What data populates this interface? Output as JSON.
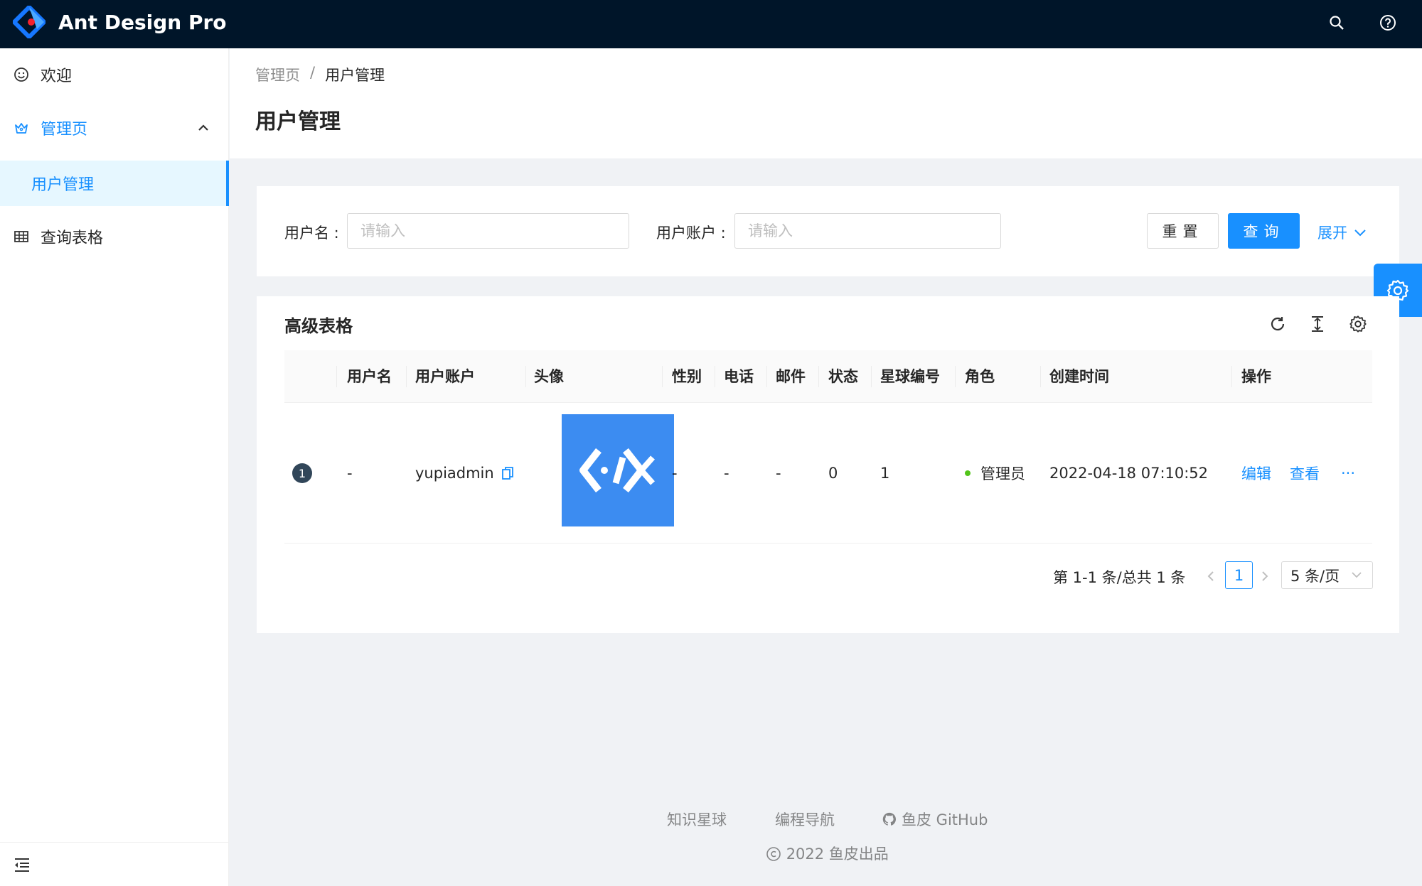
{
  "header": {
    "app_title": "Ant Design Pro",
    "icons": [
      "search-icon",
      "question-circle-icon"
    ]
  },
  "sidebar": {
    "items": [
      {
        "label": "欢迎",
        "icon": "smile-icon"
      },
      {
        "label": "管理页",
        "icon": "crown-icon",
        "expanded": true,
        "children": [
          {
            "label": "用户管理",
            "selected": true
          }
        ]
      },
      {
        "label": "查询表格",
        "icon": "table-icon"
      }
    ],
    "collapse_icon": "menu-fold-icon"
  },
  "page_header": {
    "breadcrumb": [
      "管理页",
      "/",
      "用户管理"
    ],
    "title": "用户管理"
  },
  "search_form": {
    "username_label": "用户名 :",
    "username_placeholder": "请输入",
    "username_value": "",
    "account_label": "用户账户 :",
    "account_placeholder": "请输入",
    "account_value": "",
    "reset_label": "重置",
    "query_label": "查询",
    "expand_label": "展开"
  },
  "table": {
    "title": "高级表格",
    "toolbar_icons": [
      "reload-icon",
      "column-height-icon",
      "setting-icon"
    ],
    "columns": [
      "用户名",
      "用户账户",
      "头像",
      "性别",
      "电话",
      "邮件",
      "状态",
      "星球编号",
      "角色",
      "创建时间",
      "操作"
    ],
    "rows": [
      {
        "index": "1",
        "username": "-",
        "account": "yupiadmin",
        "avatar": "code-logo",
        "gender": "-",
        "phone": "-",
        "email": "-",
        "status": "0",
        "planet_code": "1",
        "role": "管理员",
        "created_at": "2022-04-18 07:10:52",
        "actions": [
          "编辑",
          "查看",
          "···"
        ]
      }
    ],
    "pagination": {
      "total_text": "第 1-1 条/总共 1 条",
      "current_page": "1",
      "page_size": "5 条/页"
    }
  },
  "footer": {
    "links": [
      "知识星球",
      "编程导航",
      "鱼皮 GitHub"
    ],
    "copyright": "2022 鱼皮出品"
  },
  "colors": {
    "header_bg": "#001529",
    "primary": "#1890ff",
    "status_success": "#52c41a",
    "avatar_bg": "#3c8cf1"
  }
}
